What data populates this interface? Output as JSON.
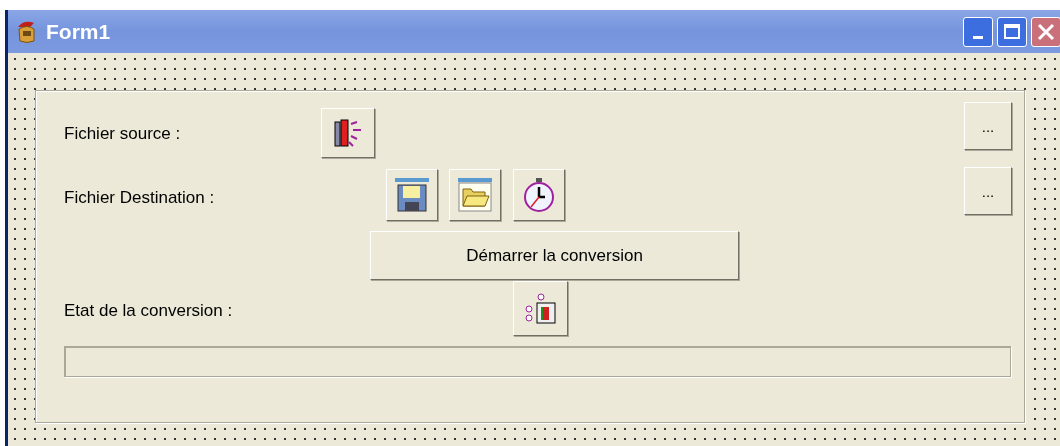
{
  "window": {
    "title": "Form1"
  },
  "source": {
    "label": "Fichier source :",
    "browse": "..."
  },
  "destination": {
    "label": "Fichier Destination :",
    "browse": "..."
  },
  "start_button": "Démarrer la conversion",
  "status": {
    "label": "Etat de la conversion :",
    "progress": {
      "level": 0
    }
  }
}
